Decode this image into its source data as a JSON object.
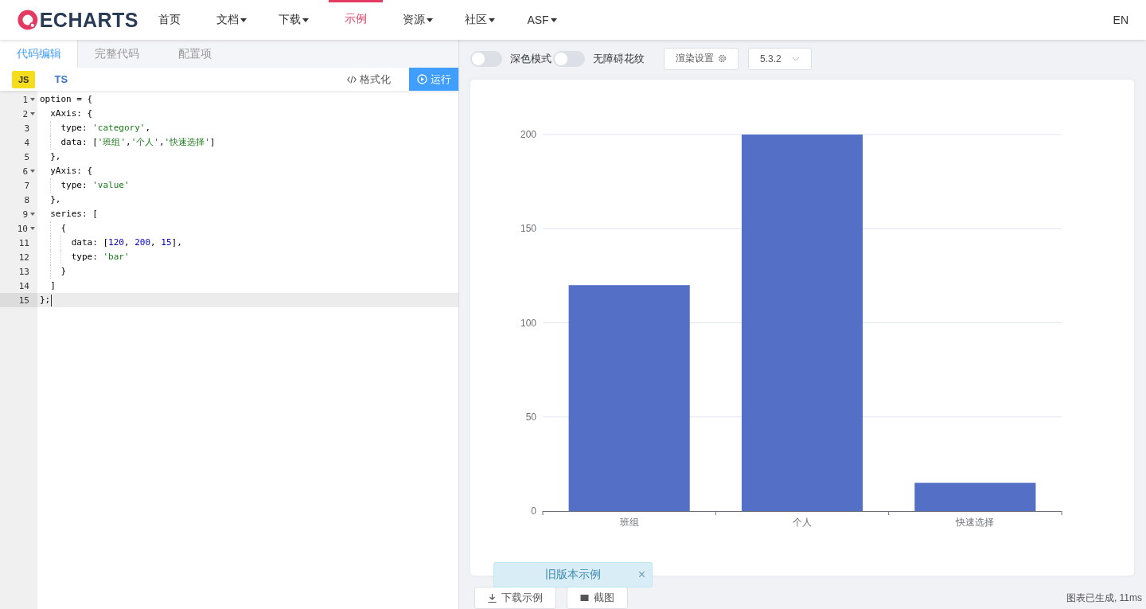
{
  "header": {
    "logo": "ECHARTS",
    "nav": [
      {
        "label": "首页",
        "selected": false,
        "dropdown": false
      },
      {
        "label": "文档",
        "selected": false,
        "dropdown": true
      },
      {
        "label": "下载",
        "selected": false,
        "dropdown": true
      },
      {
        "label": "示例",
        "selected": true,
        "dropdown": false
      },
      {
        "label": "资源",
        "selected": false,
        "dropdown": true
      },
      {
        "label": "社区",
        "selected": false,
        "dropdown": true
      },
      {
        "label": "ASF",
        "selected": false,
        "dropdown": true
      }
    ],
    "language": "EN"
  },
  "editor": {
    "tabs": [
      {
        "label": "代码编辑",
        "selected": true
      },
      {
        "label": "完整代码",
        "selected": false
      },
      {
        "label": "配置项",
        "selected": false
      }
    ],
    "languages": [
      {
        "label": "JS",
        "selected": true
      },
      {
        "label": "TS",
        "selected": false
      }
    ],
    "format_button": "格式化",
    "run_button": "运行",
    "lines": [
      {
        "number": "1",
        "fold": true,
        "active": false,
        "tokens": [
          {
            "kind": "plain",
            "text": "option = {"
          }
        ]
      },
      {
        "number": "2",
        "fold": true,
        "active": false,
        "tokens": [
          {
            "kind": "plain",
            "text": "  xAxis: {"
          }
        ]
      },
      {
        "number": "3",
        "fold": false,
        "active": false,
        "tokens": [
          {
            "kind": "plain",
            "text": "    type: "
          },
          {
            "kind": "string",
            "text": "'category'"
          },
          {
            "kind": "plain",
            "text": ","
          }
        ]
      },
      {
        "number": "4",
        "fold": false,
        "active": false,
        "tokens": [
          {
            "kind": "plain",
            "text": "    data: ["
          },
          {
            "kind": "string",
            "text": "'班组'"
          },
          {
            "kind": "plain",
            "text": ","
          },
          {
            "kind": "string",
            "text": "'个人'"
          },
          {
            "kind": "plain",
            "text": ","
          },
          {
            "kind": "string",
            "text": "'快速选择'"
          },
          {
            "kind": "plain",
            "text": "]"
          }
        ]
      },
      {
        "number": "5",
        "fold": false,
        "active": false,
        "tokens": [
          {
            "kind": "plain",
            "text": "  },"
          }
        ]
      },
      {
        "number": "6",
        "fold": true,
        "active": false,
        "tokens": [
          {
            "kind": "plain",
            "text": "  yAxis: {"
          }
        ]
      },
      {
        "number": "7",
        "fold": false,
        "active": false,
        "tokens": [
          {
            "kind": "plain",
            "text": "    type: "
          },
          {
            "kind": "string",
            "text": "'value'"
          }
        ]
      },
      {
        "number": "8",
        "fold": false,
        "active": false,
        "tokens": [
          {
            "kind": "plain",
            "text": "  },"
          }
        ]
      },
      {
        "number": "9",
        "fold": true,
        "active": false,
        "tokens": [
          {
            "kind": "plain",
            "text": "  series: ["
          }
        ]
      },
      {
        "number": "10",
        "fold": true,
        "active": false,
        "tokens": [
          {
            "kind": "plain",
            "text": "    {"
          }
        ]
      },
      {
        "number": "11",
        "fold": false,
        "active": false,
        "tokens": [
          {
            "kind": "plain",
            "text": "      data: ["
          },
          {
            "kind": "number",
            "text": "120"
          },
          {
            "kind": "plain",
            "text": ", "
          },
          {
            "kind": "number",
            "text": "200"
          },
          {
            "kind": "plain",
            "text": ", "
          },
          {
            "kind": "number",
            "text": "15"
          },
          {
            "kind": "plain",
            "text": "],"
          }
        ]
      },
      {
        "number": "12",
        "fold": false,
        "active": false,
        "tokens": [
          {
            "kind": "plain",
            "text": "      type: "
          },
          {
            "kind": "string",
            "text": "'bar'"
          }
        ]
      },
      {
        "number": "13",
        "fold": false,
        "active": false,
        "tokens": [
          {
            "kind": "plain",
            "text": "    }"
          }
        ]
      },
      {
        "number": "14",
        "fold": false,
        "active": false,
        "tokens": [
          {
            "kind": "plain",
            "text": "  ]"
          }
        ]
      },
      {
        "number": "15",
        "fold": false,
        "active": true,
        "tokens": [
          {
            "kind": "plain",
            "text": "};"
          }
        ]
      }
    ]
  },
  "preview": {
    "switches": [
      {
        "label": "深色模式",
        "on": false
      },
      {
        "label": "无障碍花纹",
        "on": false
      }
    ],
    "render_settings": "渲染设置",
    "version": "5.3.2",
    "chart_data": {
      "type": "bar",
      "categories": [
        "班组",
        "个人",
        "快速选择"
      ],
      "series": [
        {
          "color": "#5470c6",
          "values": [
            120,
            200,
            15
          ]
        }
      ],
      "ylim": [
        0,
        200
      ],
      "yticks": [
        0,
        50,
        100,
        150,
        200
      ],
      "grid": true
    },
    "buttons": [
      "下载示例",
      "截图"
    ],
    "status": "图表已生成, 11ms",
    "toast": "旧版本示例",
    "toast_close": "×"
  }
}
